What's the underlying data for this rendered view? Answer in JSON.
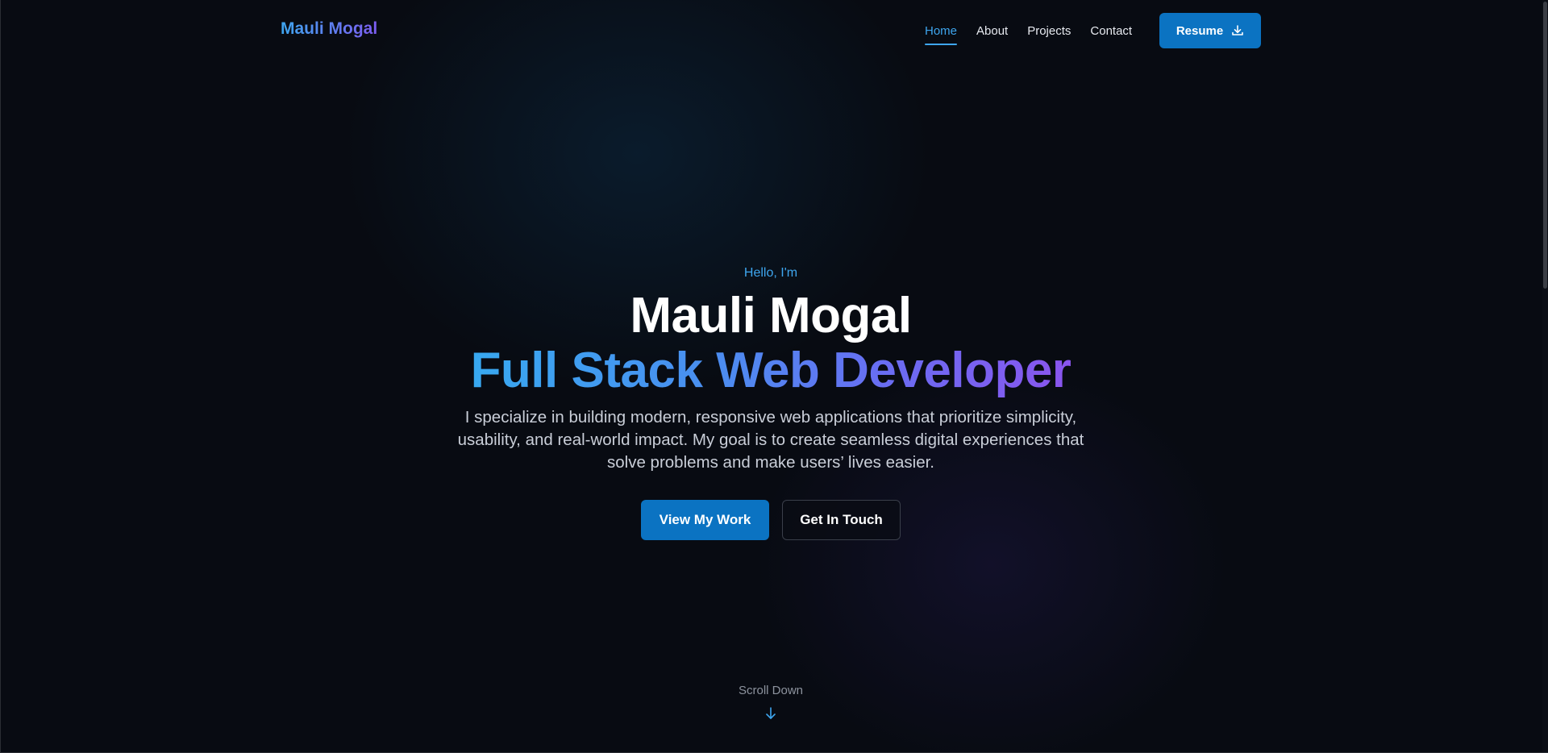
{
  "nav": {
    "brand": "Mauli Mogal",
    "links": [
      {
        "label": "Home",
        "active": true
      },
      {
        "label": "About",
        "active": false
      },
      {
        "label": "Projects",
        "active": false
      },
      {
        "label": "Contact",
        "active": false
      }
    ],
    "resume_label": "Resume",
    "resume_icon": "download-icon"
  },
  "hero": {
    "greeting": "Hello, I'm",
    "name": "Mauli Mogal",
    "role": "Full Stack Web Developer",
    "intro": "I specialize in building modern, responsive web applications that prioritize simplicity, usability, and real-world impact. My goal is to create seamless digital experiences that solve problems and make users’ lives easier.",
    "primary_button": "View My Work",
    "secondary_button": "Get In Touch"
  },
  "scroll": {
    "label": "Scroll Down",
    "icon": "arrow-down-icon"
  },
  "colors": {
    "accent": "#3ea6ef",
    "button": "#0b73c2",
    "gradient_start": "#38a9f0",
    "gradient_end": "#8a55ee",
    "background": "#080b12"
  }
}
